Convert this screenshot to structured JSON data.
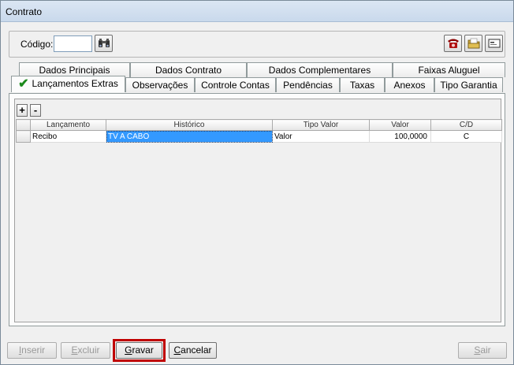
{
  "window": {
    "title": "Contrato"
  },
  "toolbar": {
    "codigo_label": "Código:",
    "codigo_value": "",
    "icons": [
      "binoculars-icon",
      "phone-icon",
      "folder-icon",
      "card-icon"
    ]
  },
  "tabs": {
    "row1": [
      "Dados Principais",
      "Dados Contrato",
      "Dados Complementares",
      "Faixas Aluguel"
    ],
    "row2": [
      "Lançamentos Extras",
      "Observações",
      "Controle Contas",
      "Pendências",
      "Taxas",
      "Anexos",
      "Tipo Garantia"
    ],
    "active": "Lançamentos Extras"
  },
  "grid": {
    "add_label": "+",
    "remove_label": "-",
    "headers": [
      "Lançamento",
      "Histórico",
      "Tipo Valor",
      "Valor",
      "C/D"
    ],
    "rows": [
      {
        "lancamento": "Recibo",
        "historico": "TV A CABO",
        "tipo_valor": "Valor",
        "valor": "100,0000",
        "cd": "C"
      }
    ]
  },
  "buttons": {
    "inserir": {
      "pre": "",
      "key": "I",
      "post": "nserir"
    },
    "excluir": {
      "pre": "",
      "key": "E",
      "post": "xcluir"
    },
    "gravar": {
      "pre": "",
      "key": "G",
      "post": "ravar"
    },
    "cancelar": {
      "pre": "",
      "key": "C",
      "post": "ancelar"
    },
    "sair": {
      "pre": "",
      "key": "S",
      "post": "air"
    }
  },
  "colors": {
    "highlight": "#c00000",
    "selection": "#3399ff",
    "check": "#1c8a1c"
  }
}
